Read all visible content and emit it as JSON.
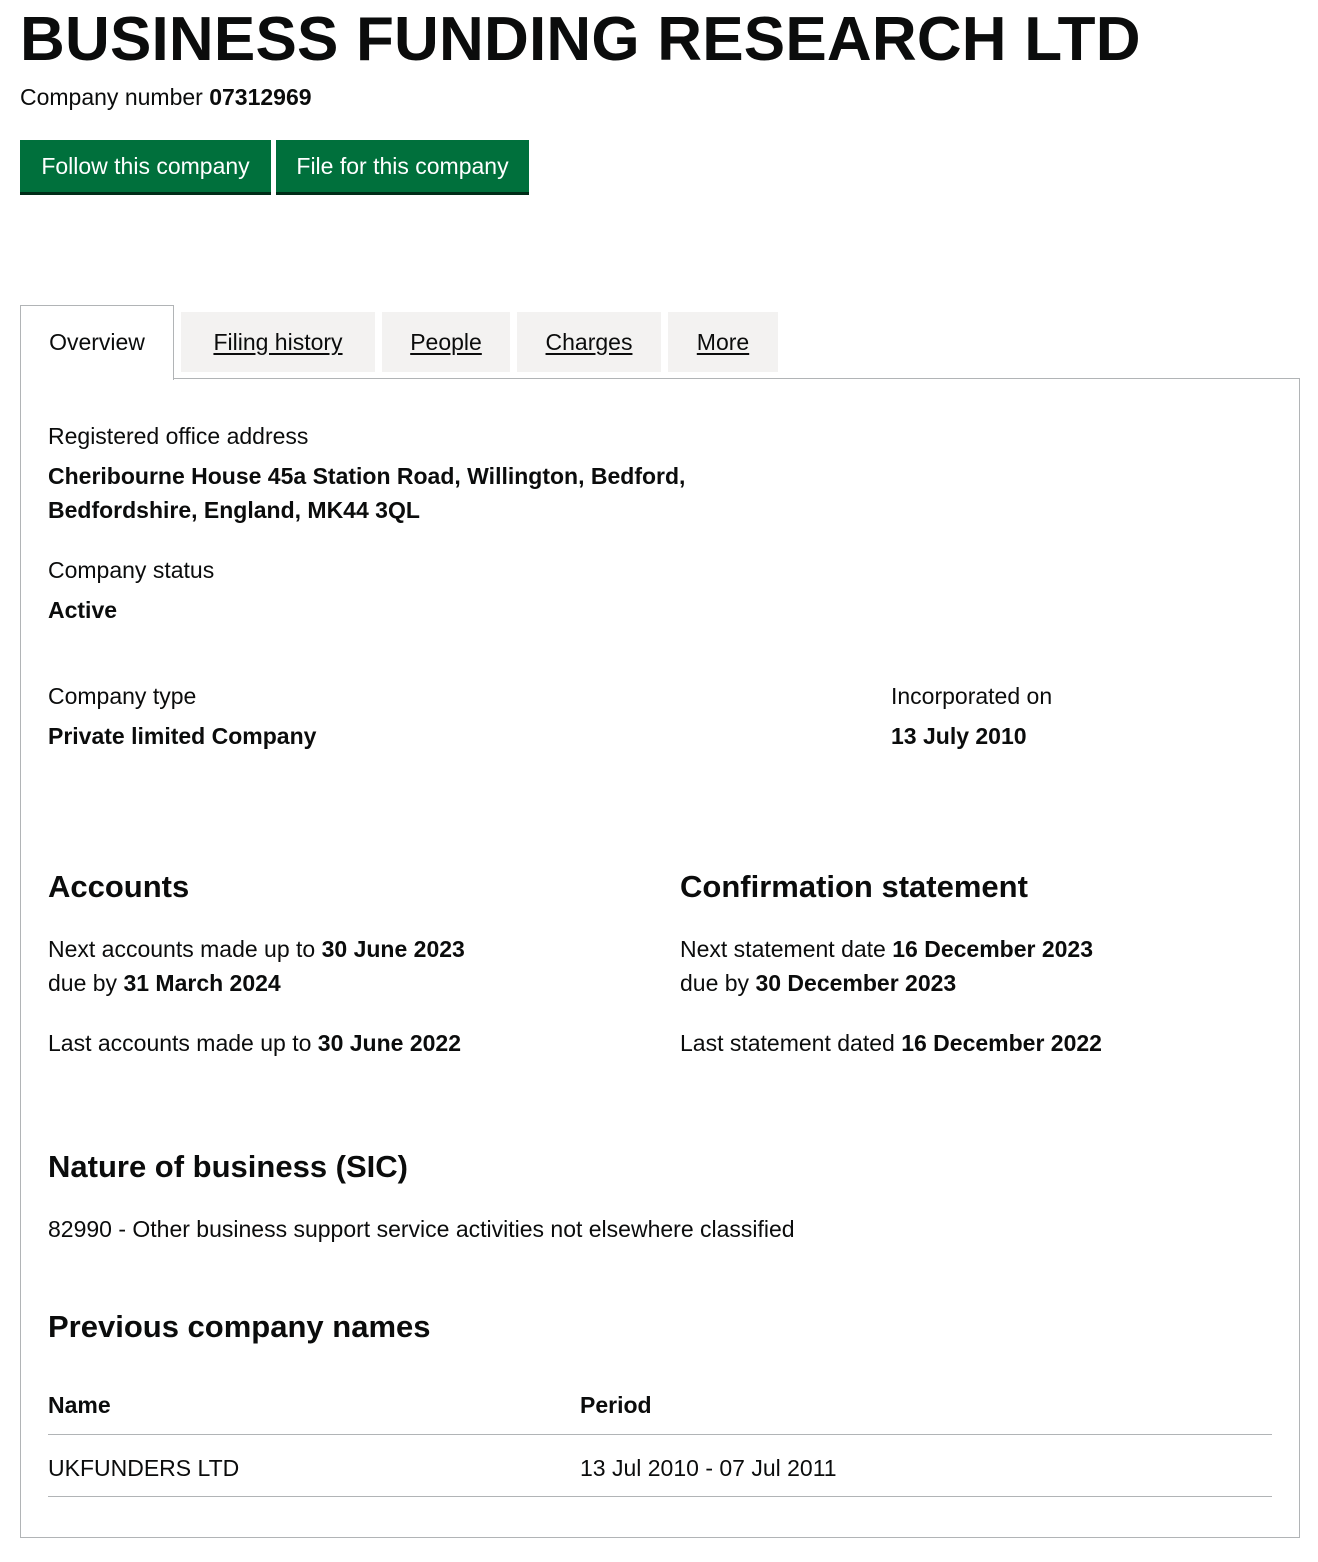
{
  "company": {
    "name": "BUSINESS FUNDING RESEARCH LTD",
    "number_label": "Company number",
    "number": "07312969"
  },
  "actions": {
    "follow_label": "Follow this company",
    "file_label": "File for this company"
  },
  "tabs": [
    {
      "label": "Overview",
      "active": true
    },
    {
      "label": "Filing history",
      "active": false
    },
    {
      "label": "People",
      "active": false
    },
    {
      "label": "Charges",
      "active": false
    },
    {
      "label": "More",
      "active": false
    }
  ],
  "overview": {
    "registered_office_label": "Registered office address",
    "registered_office_line1": "Cheribourne House 45a Station Road, Willington, Bedford,",
    "registered_office_line2": "Bedfordshire, England, MK44 3QL",
    "status_label": "Company status",
    "status": "Active",
    "type_label": "Company type",
    "type": "Private limited Company",
    "incorporated_label": "Incorporated on",
    "incorporated": "13 July 2010"
  },
  "accounts": {
    "heading": "Accounts",
    "next_prefix": "Next accounts made up to",
    "next_date": "30 June 2023",
    "due_prefix": "due by",
    "due_date": "31 March 2024",
    "last_prefix": "Last accounts made up to",
    "last_date": "30 June 2022"
  },
  "confirmation": {
    "heading": "Confirmation statement",
    "next_prefix": "Next statement date",
    "next_date": "16 December 2023",
    "due_prefix": "due by",
    "due_date": "30 December 2023",
    "last_prefix": "Last statement dated",
    "last_date": "16 December 2022"
  },
  "sic": {
    "heading": "Nature of business (SIC)",
    "entry": "82990 - Other business support service activities not elsewhere classified"
  },
  "previous_names": {
    "heading": "Previous company names",
    "columns": [
      "Name",
      "Period"
    ],
    "rows": [
      {
        "name": "UKFUNDERS LTD",
        "period": "13 Jul 2010 - 07 Jul 2011"
      }
    ]
  },
  "colors": {
    "button_green": "#00703c",
    "tab_inactive_bg": "#f3f2f1",
    "border_grey": "#b1b4b6",
    "text": "#0b0c0c"
  }
}
